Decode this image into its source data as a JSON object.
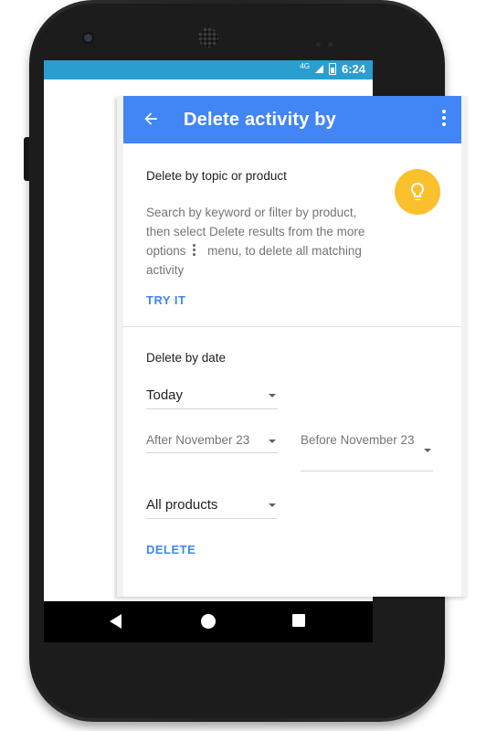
{
  "status_bar": {
    "network": "4G",
    "time": "6:24"
  },
  "appbar": {
    "title": "Delete activity by"
  },
  "topic_section": {
    "heading": "Delete by topic or product",
    "description_before": "Search by keyword or filter by product, then select Delete results from the more options",
    "description_after": "menu, to delete all matching activity",
    "action": "TRY IT"
  },
  "date_section": {
    "heading": "Delete by date",
    "range_select": "Today",
    "after_select": "After November 23",
    "before_select": "Before November 23",
    "product_select": "All products",
    "action": "DELETE"
  },
  "colors": {
    "appbar": "#4285f4",
    "status_bar": "#2b9ed1",
    "accent": "#4285f4",
    "bulb": "#fbc02d"
  },
  "icons": [
    "back-arrow-icon",
    "more-vert-icon",
    "lightbulb-icon",
    "dropdown-caret-icon",
    "signal-icon",
    "battery-charging-icon",
    "nav-back-icon",
    "nav-home-icon",
    "nav-recents-icon"
  ]
}
